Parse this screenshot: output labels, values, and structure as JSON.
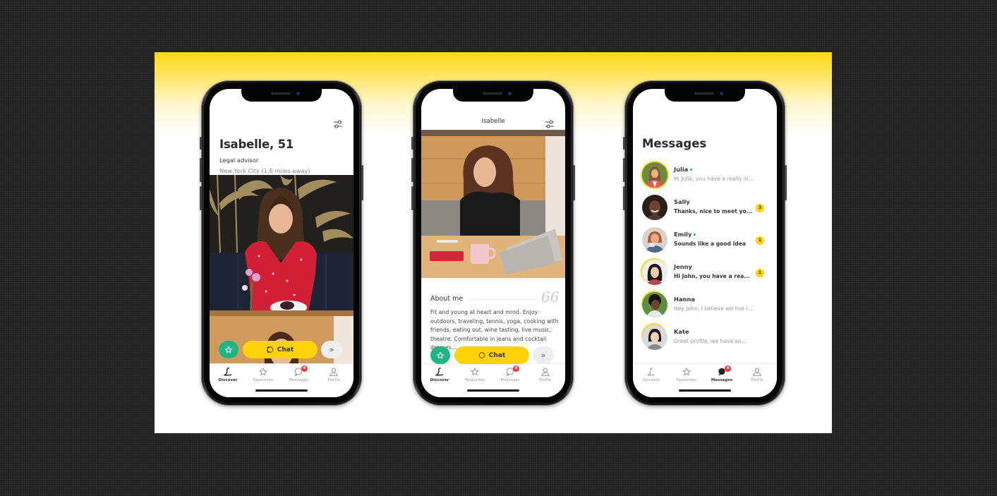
{
  "colors": {
    "brand_yellow": "#ffd20a",
    "favourite_green": "#21b585",
    "badge_red": "#ee3a43",
    "online_green": "#21b585",
    "page_background": "#232323"
  },
  "phone1": {
    "screen": "profile-card",
    "profile": {
      "name_age": "Isabelle, 51",
      "job": "Legal advisor",
      "location": "New York City (1.6 miles away)"
    },
    "icons": {
      "filter": "sliders-icon"
    },
    "actions": {
      "favourite_icon": "star-icon",
      "chat_label": "Chat",
      "chat_icon": "chat-bubble-icon",
      "skip_icon": "double-chevron-right-icon"
    }
  },
  "phone2": {
    "screen": "profile-detail",
    "header_title": "Isabelle",
    "about": {
      "title": "About me",
      "quote_icon": "quote-icon",
      "text": "Fit and young at heart and mind. Enjoy outdoors, traveling, tennis, yoga, cooking with friends, eating out, wine tasting, live music, theatre. Comfortable in jeans and cocktail dresses..."
    },
    "actions": {
      "chat_label": "Chat"
    }
  },
  "phone3": {
    "screen": "messages",
    "title": "Messages",
    "conversations": [
      {
        "name": "Julia",
        "online": true,
        "preview": "Hi Julia, you have a really ni...",
        "unread": null,
        "bold": false
      },
      {
        "name": "Sally",
        "online": false,
        "preview": "Thanks, nice to meet yo...",
        "unread": "3",
        "bold": true
      },
      {
        "name": "Emily",
        "online": true,
        "preview": "Sounds like a good idea",
        "unread": "1",
        "bold": true
      },
      {
        "name": "Jenny",
        "online": false,
        "preview": "Hi John, you have a rea...",
        "unread": "1",
        "bold": true
      },
      {
        "name": "Hanna",
        "online": false,
        "preview": "Hey John, I believe we live i...",
        "unread": null,
        "bold": false
      },
      {
        "name": "Kate",
        "online": false,
        "preview": "Great profile, we have so...",
        "unread": null,
        "bold": false
      }
    ]
  },
  "tabbar": {
    "tabs": [
      {
        "label": "Discover",
        "icon": "discover-icon"
      },
      {
        "label": "Favourites",
        "icon": "star-icon"
      },
      {
        "label": "Messages",
        "icon": "chat-bubble-icon",
        "badge": "4"
      },
      {
        "label": "Profile",
        "icon": "person-icon"
      }
    ]
  }
}
